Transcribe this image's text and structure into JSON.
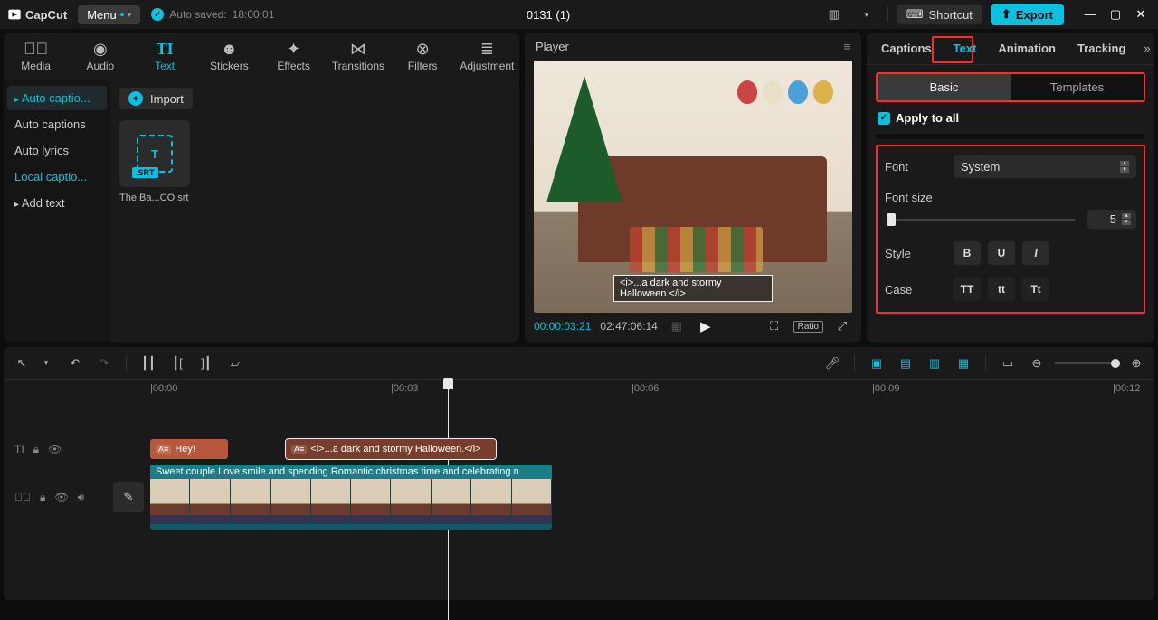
{
  "app": {
    "name": "CapCut"
  },
  "titlebar": {
    "menu": "Menu",
    "autosave_prefix": "Auto saved:",
    "autosave_time": "18:00:01",
    "project_title": "0131 (1)",
    "shortcut": "Shortcut",
    "export": "Export"
  },
  "toolbar": {
    "items": [
      "Media",
      "Audio",
      "Text",
      "Stickers",
      "Effects",
      "Transitions",
      "Filters",
      "Adjustment"
    ],
    "active_index": 2
  },
  "text_sidebar": {
    "items": [
      "Auto captio...",
      "Auto captions",
      "Auto lyrics",
      "Local captio...",
      "Add text"
    ]
  },
  "import_label": "Import",
  "srt_file": {
    "badge": ".SRT",
    "glyph": "T",
    "name": "The.Ba...CO.srt"
  },
  "player": {
    "title": "Player",
    "caption_overlay": "<i>...a dark and stormy Halloween.</i>",
    "tc_current": "00:00:03:21",
    "tc_duration": "02:47:06:14",
    "ratio_label": "Ratio"
  },
  "right": {
    "tabs": [
      "Captions",
      "Text",
      "Animation",
      "Tracking"
    ],
    "active": 1,
    "subtabs": {
      "basic": "Basic",
      "templates": "Templates",
      "active": 0
    },
    "apply_all": "Apply to all",
    "font_label": "Font",
    "font_value": "System",
    "fontsize_label": "Font size",
    "fontsize_value": "5",
    "style_label": "Style",
    "style_b": "B",
    "style_u": "U",
    "style_i": "I",
    "case_label": "Case",
    "case_upper": "TT",
    "case_lower": "tt",
    "case_title": "Tt"
  },
  "timeline": {
    "ticks": [
      "|00:00",
      "|00:03",
      "|00:06",
      "|00:09",
      "|00:12"
    ],
    "caption1": "Hey!",
    "caption2": "<i>...a dark and stormy Halloween.</i>",
    "video_label": "Sweet couple Love smile and spending Romantic christmas time and celebrating n"
  }
}
